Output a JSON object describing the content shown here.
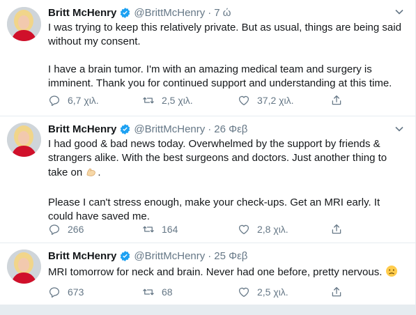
{
  "tweets": [
    {
      "author_name": "Britt McHenry",
      "handle": "@BrittMcHenry",
      "dot": "·",
      "time": "7 ώ",
      "paragraphs": [
        "I was trying to keep this relatively private. But as usual, things are being said without my consent.",
        "I have a brain tumor. I'm with an amazing medical team and surgery is imminent. Thank you for continued support and understanding at this time."
      ],
      "replies": "6,7 χιλ.",
      "retweets": "2,5 χιλ.",
      "likes": "37,2 χιλ."
    },
    {
      "author_name": "Britt McHenry",
      "handle": "@BrittMcHenry",
      "dot": "·",
      "time": "26 Φεβ",
      "paragraphs": [
        "I had good & bad news today. Overwhelmed by the support by friends & strangers alike. With the best surgeons and doctors. Just another thing to take on",
        "Please I can't stress enough, make your check-ups. Get an MRI early. It could have saved me."
      ],
      "emoji": "💪🏼",
      "replies": "266",
      "retweets": "164",
      "likes": "2,8 χιλ."
    },
    {
      "author_name": "Britt McHenry",
      "handle": "@BrittMcHenry",
      "dot": "·",
      "time": "25 Φεβ",
      "paragraphs": [
        "MRI tomorrow for neck and brain. Never had one before, pretty nervous."
      ],
      "emoji": "🙁",
      "replies": "673",
      "retweets": "68",
      "likes": "2,5 χιλ."
    }
  ],
  "icons": {
    "verified": "verified-badge-icon",
    "caret": "chevron-down-icon",
    "reply": "reply-icon",
    "retweet": "retweet-icon",
    "like": "heart-icon",
    "share": "share-icon"
  },
  "colors": {
    "twitter_blue": "#1da1f2",
    "secondary_text": "#657786",
    "divider": "#e6ecf0",
    "avatar_dress": "#d0102a"
  }
}
